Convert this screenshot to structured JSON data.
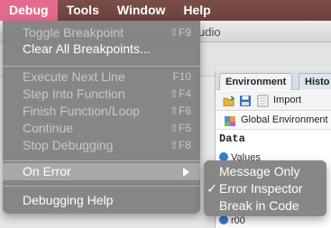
{
  "menubar": {
    "items": [
      "Debug",
      "Tools",
      "Window",
      "Help"
    ],
    "active_color": "#e36a8c"
  },
  "background": {
    "title_partial": "udio",
    "tabs": [
      "Environment",
      "Histo"
    ],
    "pane_toolbar_label": "Import",
    "env_label": "Global Environment",
    "data_header": "Data",
    "rows": [
      "Values",
      "r00"
    ]
  },
  "debug_menu": {
    "items": [
      {
        "label": "Toggle Breakpoint",
        "shortcut": "⇧F9",
        "enabled": false
      },
      {
        "label": "Clear All Breakpoints...",
        "shortcut": "",
        "enabled": true
      },
      {
        "label": "Execute Next Line",
        "shortcut": "F10",
        "enabled": false
      },
      {
        "label": "Step Into Function",
        "shortcut": "⇧F4",
        "enabled": false
      },
      {
        "label": "Finish Function/Loop",
        "shortcut": "⇧F6",
        "enabled": false
      },
      {
        "label": "Continue",
        "shortcut": "⇧F5",
        "enabled": false
      },
      {
        "label": "Stop Debugging",
        "shortcut": "⇧F8",
        "enabled": false
      },
      {
        "label": "On Error",
        "shortcut": "",
        "enabled": true,
        "submenu": true,
        "highlighted": true
      },
      {
        "label": "Debugging Help",
        "shortcut": "",
        "enabled": true
      }
    ]
  },
  "on_error_submenu": {
    "items": [
      {
        "label": "Message Only",
        "checked": false
      },
      {
        "label": "Error Inspector",
        "checked": true
      },
      {
        "label": "Break in Code",
        "checked": false
      }
    ],
    "check_glyph": "✓"
  }
}
